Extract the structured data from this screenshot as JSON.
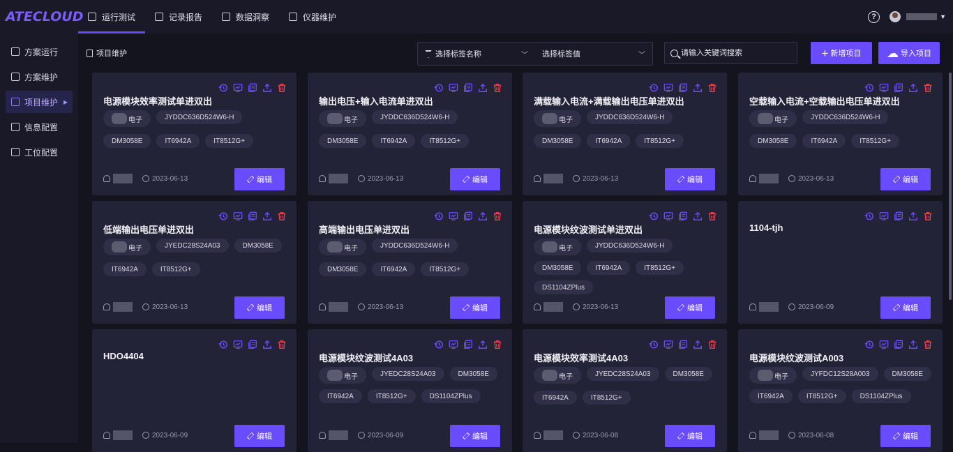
{
  "app": {
    "logo": "ATECLOUD"
  },
  "topnav": [
    {
      "label": "运行测试",
      "icon": "monitor-check-icon",
      "active": true
    },
    {
      "label": "记录报告",
      "icon": "clipboard-icon",
      "active": false
    },
    {
      "label": "数据洞察",
      "icon": "chart-monitor-icon",
      "active": false
    },
    {
      "label": "仪器维护",
      "icon": "instrument-icon",
      "active": false
    }
  ],
  "sidebar": [
    {
      "label": "方案运行",
      "icon": "monitor-play-icon",
      "active": false
    },
    {
      "label": "方案维护",
      "icon": "edit-doc-icon",
      "active": false
    },
    {
      "label": "项目维护",
      "icon": "layers-icon",
      "active": true
    },
    {
      "label": "信息配置",
      "icon": "sliders-icon",
      "active": false
    },
    {
      "label": "工位配置",
      "icon": "workstation-icon",
      "active": false
    }
  ],
  "breadcrumb": "项目维护",
  "filters": {
    "tag_name": "选择标签名称",
    "tag_value": "选择标签值"
  },
  "search": {
    "placeholder": "请输入关键词搜索"
  },
  "buttons": {
    "add": "新增项目",
    "import": "导入项目",
    "edit": "编辑"
  },
  "colors": {
    "accent": "#6a4cff",
    "danger": "#e0424a",
    "card": "#232338",
    "background": "#14141f"
  },
  "cards": [
    {
      "title": "电源模块效率测试单进双出",
      "tags": [
        "电子",
        "JYDDC636D524W6-H",
        "DM3058E",
        "IT6942A",
        "IT8512G+"
      ],
      "date": "2023-06-13"
    },
    {
      "title": "输出电压+输入电流单进双出",
      "tags": [
        "电子",
        "JYDDC636D524W6-H",
        "DM3058E",
        "IT6942A",
        "IT8512G+"
      ],
      "date": "2023-06-13"
    },
    {
      "title": "满载输入电流+满载输出电压单进双出",
      "tags": [
        "电子",
        "JYDDC636D524W6-H",
        "DM3058E",
        "IT6942A",
        "IT8512G+"
      ],
      "date": "2023-06-13"
    },
    {
      "title": "空载输入电流+空载输出电压单进双出",
      "tags": [
        "电子",
        "JYDDC636D524W6-H",
        "DM3058E",
        "IT6942A",
        "IT8512G+"
      ],
      "date": "2023-06-13"
    },
    {
      "title": "低端输出电压单进双出",
      "tags": [
        "电子",
        "JYEDC28S24A03",
        "DM3058E",
        "IT6942A",
        "IT8512G+"
      ],
      "date": "2023-06-13"
    },
    {
      "title": "高端输出电压单进双出",
      "tags": [
        "电子",
        "JYDDC636D524W6-H",
        "DM3058E",
        "IT6942A",
        "IT8512G+"
      ],
      "date": "2023-06-13"
    },
    {
      "title": "电源模块纹波测试单进双出",
      "tags": [
        "电子",
        "JYDDC636D524W6-H",
        "DM3058E",
        "IT6942A",
        "IT8512G+",
        "DS1104ZPlus"
      ],
      "date": "2023-06-13"
    },
    {
      "title": "1104-tjh",
      "tags": [],
      "date": "2023-06-09"
    },
    {
      "title": "HDO4404",
      "tags": [],
      "date": "2023-06-09"
    },
    {
      "title": "电源模块纹波测试4A03",
      "tags": [
        "电子",
        "JYEDC28S24A03",
        "DM3058E",
        "IT6942A",
        "IT8512G+",
        "DS1104ZPlus"
      ],
      "date": "2023-06-09"
    },
    {
      "title": "电源模块效率测试4A03",
      "tags": [
        "电子",
        "JYEDC28S24A03",
        "DM3058E",
        "IT6942A",
        "IT8512G+"
      ],
      "date": "2023-06-08"
    },
    {
      "title": "电源模块纹波测试A003",
      "tags": [
        "电子",
        "JYFDC12S28A003",
        "DM3058E",
        "IT6942A",
        "IT8512G+",
        "DS1104ZPlus"
      ],
      "date": "2023-06-08"
    }
  ]
}
